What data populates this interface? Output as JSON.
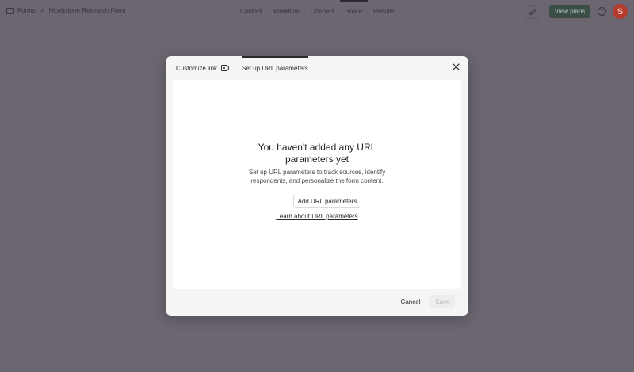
{
  "topbar": {
    "breadcrumbs": [
      "Forms",
      "Nicelydone Research Form"
    ],
    "separator": ">",
    "nav_tabs": [
      {
        "label": "Content"
      },
      {
        "label": "Workflow"
      },
      {
        "label": "Connect"
      },
      {
        "label": "Share",
        "active": true
      },
      {
        "label": "Results"
      }
    ],
    "view_plans_label": "View plans",
    "icons": [
      "forms-icon",
      "link-icon",
      "help-icon",
      "avatar"
    ]
  },
  "modal": {
    "tabs": [
      {
        "label": "Customize link",
        "icon": "tag-icon"
      },
      {
        "label": "Set up URL parameters",
        "active": true
      }
    ],
    "empty_state": {
      "title": "You haven't added any URL parameters yet",
      "title_line1": "You haven't added any URL",
      "title_line2": "parameters yet",
      "description_line1": "Set up URL parameters to track sources, identify",
      "description_line2": "respondents, and personalize the form content.",
      "add_button_label": "Add URL parameters",
      "learn_link_label": "Learn about URL parameters"
    },
    "footer": {
      "cancel_label": "Cancel",
      "save_label": "Save"
    }
  },
  "colors": {
    "overlay_bg": "#6b6670",
    "primary_btn_bg": "#3b4f47",
    "avatar_bg": "#b33a2c"
  }
}
